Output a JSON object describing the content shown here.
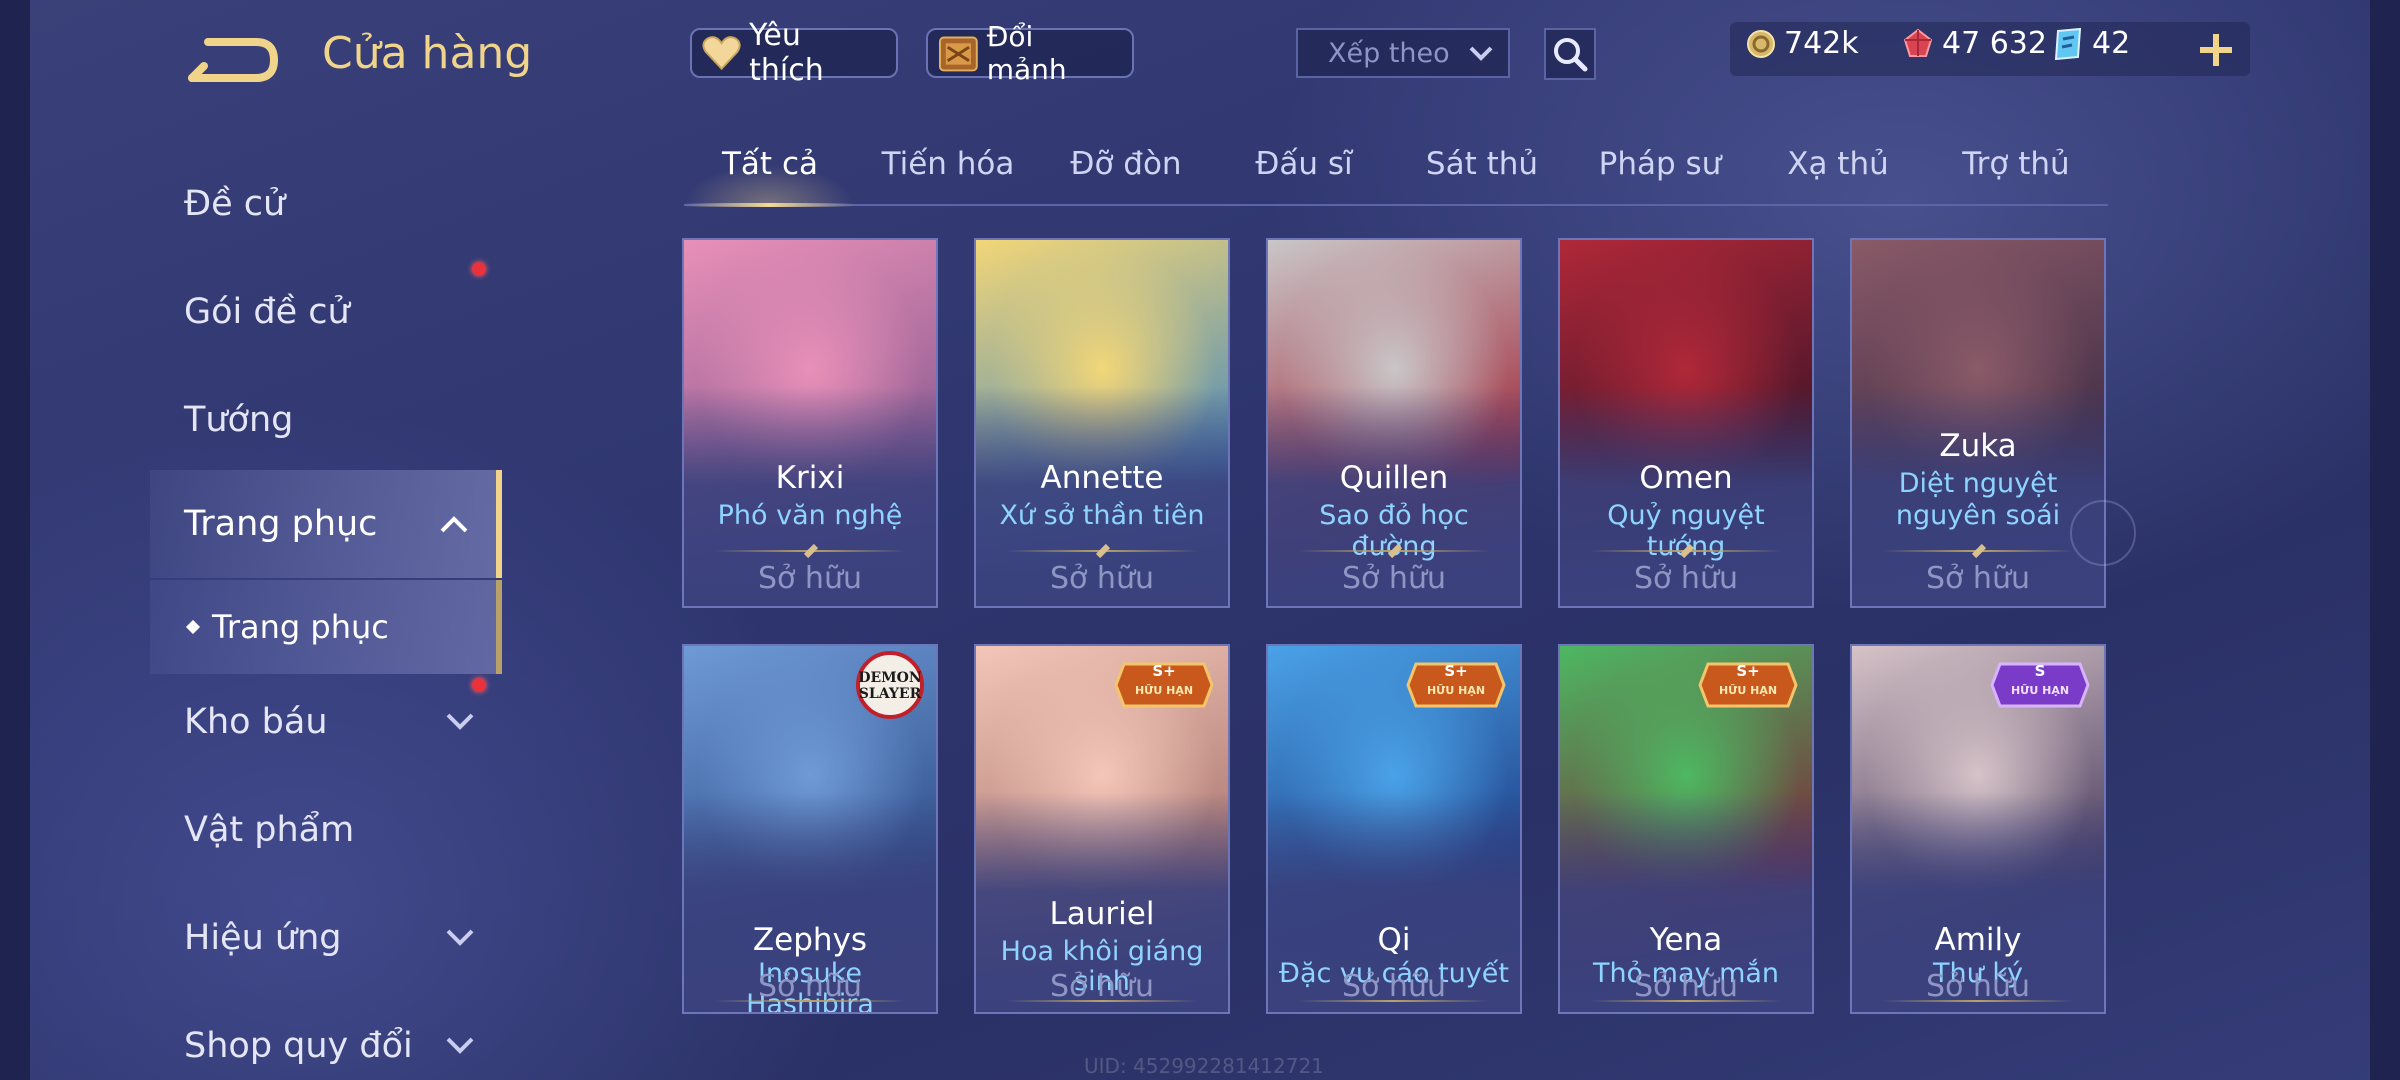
{
  "header": {
    "title": "Cửa hàng",
    "favorite_label": "Yêu thích",
    "shard_label": "Đổi mảnh",
    "sort_label": "Xếp theo"
  },
  "currency": {
    "gold": "742k",
    "ruby": "47 632",
    "voucher": "42"
  },
  "sidebar": {
    "items": [
      {
        "label": "Đề cử"
      },
      {
        "label": "Gói đề cử"
      },
      {
        "label": "Tướng"
      },
      {
        "label": "Trang phục"
      },
      {
        "label": "Trang phục"
      },
      {
        "label": "Kho báu"
      },
      {
        "label": "Vật phẩm"
      },
      {
        "label": "Hiệu ứng"
      },
      {
        "label": "Shop quy đổi"
      }
    ]
  },
  "tabs": [
    "Tất cả",
    "Tiến hóa",
    "Đỡ đòn",
    "Đấu sĩ",
    "Sát thủ",
    "Pháp sư",
    "Xạ thủ",
    "Trợ thủ"
  ],
  "cards": [
    {
      "name": "Krixi",
      "skin": "Phó văn nghệ",
      "status": "Sở hữu",
      "theme": [
        "#e890b8",
        "#8a5a90"
      ]
    },
    {
      "name": "Annette",
      "skin": "Xứ sở thần tiên",
      "status": "Sở hữu",
      "theme": [
        "#f2d678",
        "#4c8ab8"
      ]
    },
    {
      "name": "Quillen",
      "skin": "Sao đỏ học đường",
      "status": "Sở hữu",
      "theme": [
        "#c9c6c8",
        "#a0283a"
      ]
    },
    {
      "name": "Omen",
      "skin": "Quỷ nguyệt tướng",
      "status": "Sở hữu",
      "theme": [
        "#b02838",
        "#3a1228"
      ]
    },
    {
      "name": "Zuka",
      "skin_line1": "Diệt nguyệt",
      "skin_line2": "nguyên soái",
      "status": "Sở hữu",
      "theme": [
        "#8a5a68",
        "#3c2a44"
      ]
    },
    {
      "name": "Zephys",
      "skin": "Inosuke Hashibira",
      "status": "Sở hữu",
      "badge": "DEMON SLAYER",
      "theme": [
        "#6f9ad6",
        "#2e4e8a"
      ]
    },
    {
      "name": "Lauriel",
      "skin_line1": "Hoa khôi giáng",
      "skin_line2": "sinh",
      "status": "Sở hữu",
      "badge_rank": "S+",
      "badge_text": "HỮU HẠN",
      "theme": [
        "#f3c6b8",
        "#a8746e"
      ]
    },
    {
      "name": "Qi",
      "skin": "Đặc vụ cáo tuyết",
      "status": "Sở hữu",
      "badge_rank": "S+",
      "badge_text": "HỮU HẠN",
      "theme": [
        "#4aa2e8",
        "#1e3e86"
      ]
    },
    {
      "name": "Yena",
      "skin": "Thỏ may mắn",
      "status": "Sở hữu",
      "badge_rank": "S+",
      "badge_text": "HỮU HẠN",
      "theme": [
        "#4db862",
        "#7a2838"
      ]
    },
    {
      "name": "Amily",
      "skin": "Thư ký",
      "status": "Sở hữu",
      "badge_rank": "S",
      "badge_text": "HỮU HẠN",
      "theme": [
        "#d6c3c8",
        "#4a3c5e"
      ]
    }
  ],
  "footer": {
    "uid": "UID: 452992281412721"
  },
  "colors": {
    "gold_accent": "#f0d48a",
    "skin_name": "#8ed4ff",
    "owned": "#8f96c4",
    "notify_dot": "#e8323c"
  }
}
